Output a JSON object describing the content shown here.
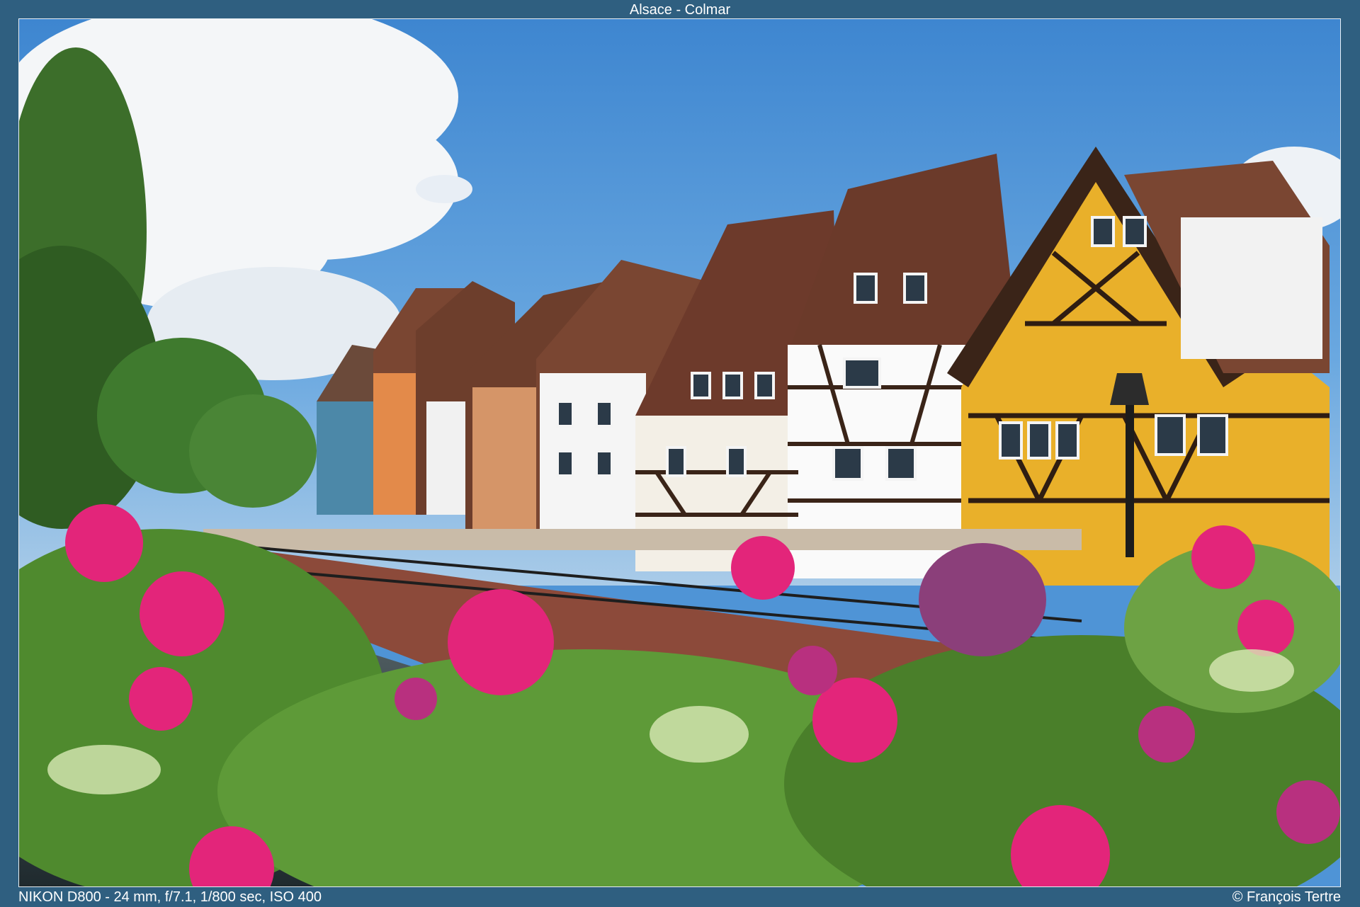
{
  "header": {
    "title": "Alsace - Colmar"
  },
  "photo": {
    "subject": "photograph"
  },
  "footer": {
    "exif": "NIKON D800 - 24 mm, f/7.1, 1/800 sec, ISO 400",
    "copyright": "© François Tertre"
  },
  "colors": {
    "frame": "#2f5f80",
    "sky": "#4f94d6",
    "yellow_house": "#e9b02a",
    "roof": "#7a4632",
    "flowers": "#e3257a",
    "leaves": "#4f8a2e"
  }
}
